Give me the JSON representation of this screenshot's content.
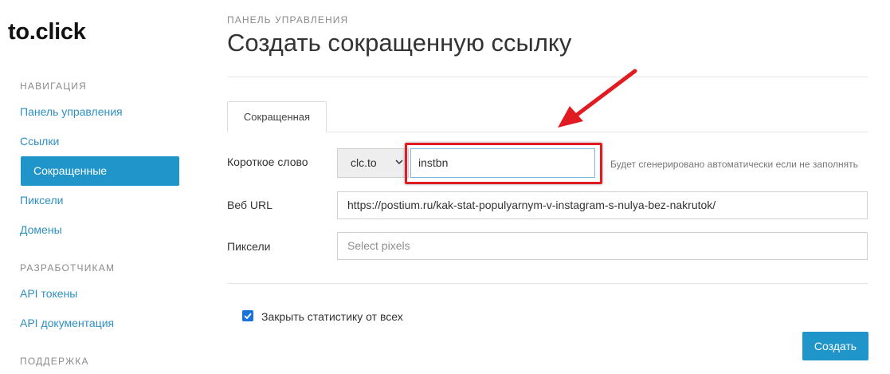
{
  "brand": {
    "logo": "to.click"
  },
  "sidebar": {
    "sections": [
      {
        "heading": "НАВИГАЦИЯ",
        "items": [
          "Панель управления",
          "Ссылки",
          "Сокращенные",
          "Пиксели",
          "Домены"
        ],
        "active": "Сокращенные"
      },
      {
        "heading": "РАЗРАБОТЧИКАМ",
        "items": [
          "API токены",
          "API документация"
        ]
      },
      {
        "heading": "ПОДДЕРЖКА",
        "items": []
      }
    ]
  },
  "main": {
    "breadcrumb": "ПАНЕЛЬ УПРАВЛЕНИЯ",
    "title": "Создать сокращенную ссылку",
    "tabs": [
      {
        "label": "Сокращенная",
        "active": true
      }
    ],
    "form": {
      "short_word": {
        "label": "Короткое слово",
        "domain_selected": "clc.to",
        "value": "instbn",
        "hint": "Будет сгенерировано автоматически если не заполнять"
      },
      "web_url": {
        "label": "Веб URL",
        "value": "https://postium.ru/kak-stat-populyarnym-v-instagram-s-nulya-bez-nakrutok/"
      },
      "pixels": {
        "label": "Пиксели",
        "placeholder": "Select pixels"
      },
      "hide_stats": {
        "label": "Закрыть статистику от всех",
        "checked": true
      },
      "submit_label": "Создать"
    }
  },
  "colors": {
    "accent": "#1f95c9",
    "link": "#2e8fc4",
    "annotation_red": "#e11b22",
    "checkbox": "#1a73d9"
  }
}
